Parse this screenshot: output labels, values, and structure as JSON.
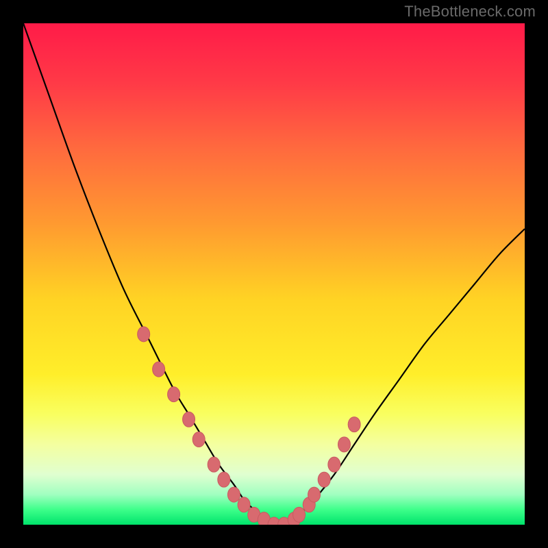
{
  "watermark": "TheBottleneck.com",
  "colors": {
    "frame": "#000000",
    "curve": "#000000",
    "marker_fill": "#d86a6f",
    "marker_stroke": "#c85a60"
  },
  "chart_data": {
    "type": "line",
    "title": "",
    "xlabel": "",
    "ylabel": "",
    "xlim": [
      0,
      100
    ],
    "ylim": [
      0,
      100
    ],
    "grid": false,
    "legend": false,
    "series": [
      {
        "name": "bottleneck-curve",
        "x": [
          0,
          5,
          10,
          15,
          20,
          25,
          30,
          33,
          36,
          39,
          42,
          44,
          46,
          48,
          50,
          52,
          55,
          58,
          62,
          66,
          70,
          75,
          80,
          85,
          90,
          95,
          100
        ],
        "values": [
          100,
          86,
          72,
          59,
          47,
          37,
          27,
          22,
          17,
          12,
          8,
          5,
          3,
          1,
          0,
          0,
          2,
          5,
          10,
          16,
          22,
          29,
          36,
          42,
          48,
          54,
          59
        ]
      }
    ],
    "markers": {
      "name": "highlighted-points",
      "x": [
        24,
        27,
        30,
        33,
        35,
        38,
        40,
        42,
        44,
        46,
        48,
        50,
        52,
        54,
        55,
        57,
        58,
        60,
        62,
        64,
        66
      ],
      "values": [
        38,
        31,
        26,
        21,
        17,
        12,
        9,
        6,
        4,
        2,
        1,
        0,
        0,
        1,
        2,
        4,
        6,
        9,
        12,
        16,
        20
      ]
    }
  }
}
